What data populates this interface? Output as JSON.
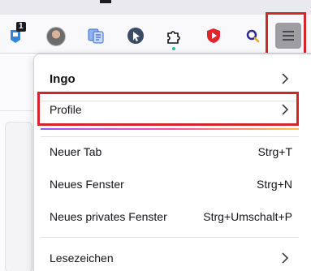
{
  "toolbar": {
    "notification_badge": "1",
    "icons": [
      "extension-badge-icon",
      "avatar",
      "translate-icon",
      "cursor-icon",
      "puzzle-icon",
      "shield-play-icon",
      "search-extension-icon",
      "hamburger-menu-icon"
    ]
  },
  "menu": {
    "account_name": "Ingo",
    "profile_label": "Profile",
    "items": [
      {
        "label": "Neuer Tab",
        "shortcut": "Strg+T"
      },
      {
        "label": "Neues Fenster",
        "shortcut": "Strg+N"
      },
      {
        "label": "Neues privates Fenster",
        "shortcut": "Strg+Umschalt+P"
      }
    ],
    "bookmarks_label": "Lesezeichen"
  },
  "colors": {
    "highlight": "#d0262c",
    "menu_button_bg": "#9e9ea2"
  }
}
